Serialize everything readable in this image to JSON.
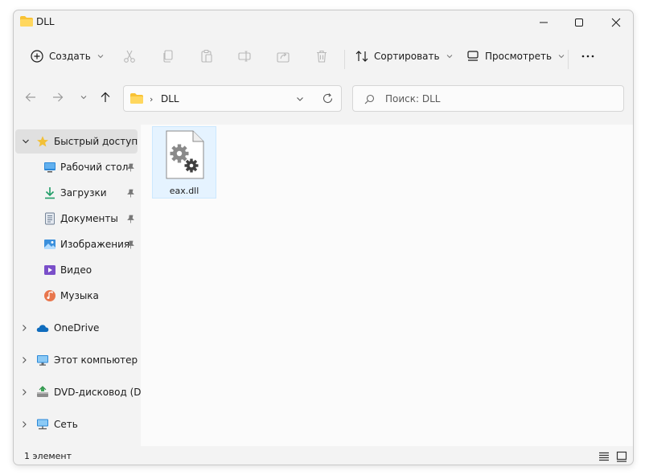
{
  "window": {
    "title": "DLL"
  },
  "commands": {
    "create": "Создать",
    "sort": "Сортировать",
    "view": "Просмотреть"
  },
  "address": {
    "crumb": "DLL",
    "search_placeholder": "Поиск: DLL"
  },
  "sidebar": {
    "quick_access": "Быстрый доступ",
    "items": [
      {
        "label": "Рабочий стол",
        "icon": "desktop-icon",
        "pinned": true
      },
      {
        "label": "Загрузки",
        "icon": "download-icon",
        "pinned": true
      },
      {
        "label": "Документы",
        "icon": "documents-icon",
        "pinned": true
      },
      {
        "label": "Изображения",
        "icon": "pictures-icon",
        "pinned": true
      },
      {
        "label": "Видео",
        "icon": "video-icon",
        "pinned": false
      },
      {
        "label": "Музыка",
        "icon": "music-icon",
        "pinned": false
      }
    ],
    "onedrive": "OneDrive",
    "this_pc": "Этот компьютер",
    "dvd": "DVD-дисковод (D:)",
    "network": "Сеть"
  },
  "files": [
    {
      "name": "eax.dll",
      "icon": "dll-settings-icon"
    }
  ],
  "status": {
    "count": "1 элемент"
  },
  "colors": {
    "accent": "#0067c0",
    "folder": "#f8c234",
    "selection": "#e5f3ff"
  }
}
